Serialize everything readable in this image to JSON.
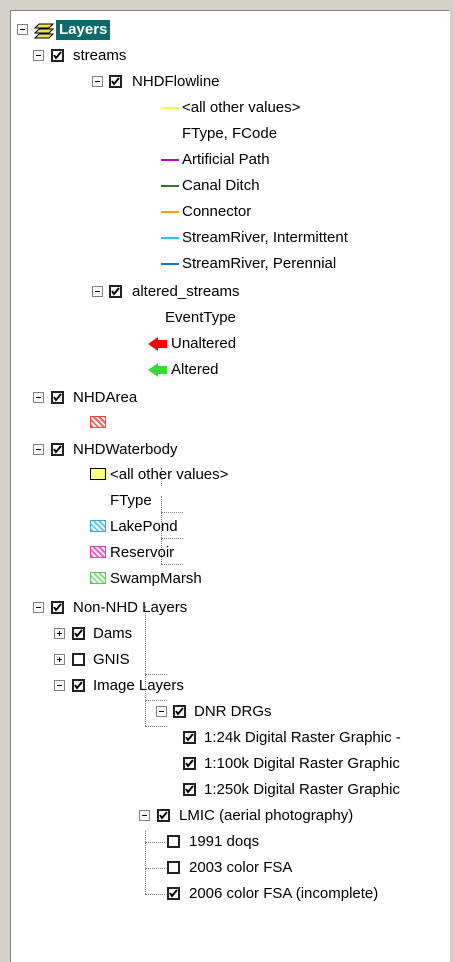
{
  "toc": {
    "root": "Layers",
    "streams": {
      "label": "streams",
      "flowline": {
        "label": "NHDFlowline",
        "all_other": "<all other values>",
        "heading": "FType, FCode",
        "classes": [
          {
            "label": "Artificial Path",
            "color": "#cc00cc"
          },
          {
            "label": "Canal Ditch",
            "color": "#2a7a2a"
          },
          {
            "label": "Connector",
            "color": "#ffa500"
          },
          {
            "label": "StreamRiver, Intermittent",
            "color": "#22c8f5"
          },
          {
            "label": "StreamRiver, Perennial",
            "color": "#1e6fe0"
          }
        ],
        "all_other_color": "#ffff33"
      },
      "altered": {
        "label": "altered_streams",
        "heading": "EventType",
        "classes": [
          {
            "label": "Unaltered",
            "color": "#ff0000"
          },
          {
            "label": "Altered",
            "color": "#33dd33"
          }
        ]
      }
    },
    "area": {
      "label": "NHDArea",
      "color": "#ff6060"
    },
    "waterbody": {
      "label": "NHDWaterbody",
      "all_other": "<all other values>",
      "all_other_color": "#ffff80",
      "heading": "FType",
      "classes": [
        {
          "label": "LakePond",
          "color": "#5cc8f0"
        },
        {
          "label": "Reservoir",
          "color": "#ff55cc"
        },
        {
          "label": "SwampMarsh",
          "color": "#88dd88"
        }
      ]
    },
    "nonnhd": {
      "label": "Non-NHD Layers",
      "dams": "Dams",
      "gnis": "GNIS",
      "image": {
        "label": "Image Layers",
        "drg": {
          "label": "DNR DRGs",
          "items": [
            "1:24k Digital Raster Graphic -",
            "1:100k Digital Raster Graphic",
            "1:250k Digital Raster Graphic"
          ]
        },
        "lmic": {
          "label": "LMIC (aerial photography)",
          "items": [
            "1991 doqs",
            "2003 color FSA",
            "2006 color FSA (incomplete)"
          ]
        }
      }
    }
  }
}
